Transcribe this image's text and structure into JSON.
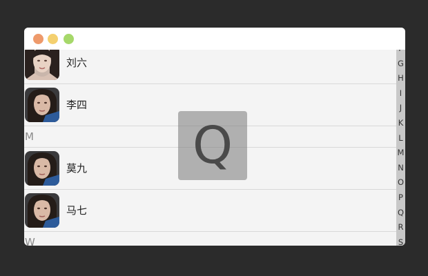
{
  "window": {
    "controls": [
      {
        "name": "close-button",
        "color": "#ee9a6b"
      },
      {
        "name": "minimize-button",
        "color": "#f4d06f"
      },
      {
        "name": "zoom-button",
        "color": "#a6d86a"
      }
    ]
  },
  "contacts": {
    "rows": [
      {
        "type": "contact",
        "name": "刘六",
        "avatar": "avatar-dark-hair-portrait"
      },
      {
        "type": "contact",
        "name": "李四",
        "avatar": "avatar-long-hair-portrait"
      },
      {
        "type": "section",
        "letter": "M"
      },
      {
        "type": "contact",
        "name": "莫九",
        "avatar": "avatar-long-hair-portrait"
      },
      {
        "type": "contact",
        "name": "马七",
        "avatar": "avatar-long-hair-portrait"
      },
      {
        "type": "section",
        "letter": "W"
      }
    ]
  },
  "index_bar": {
    "letters": [
      "F",
      "G",
      "H",
      "I",
      "J",
      "K",
      "L",
      "M",
      "N",
      "O",
      "P",
      "Q",
      "R",
      "S"
    ]
  },
  "overlay": {
    "letter": "Q"
  }
}
